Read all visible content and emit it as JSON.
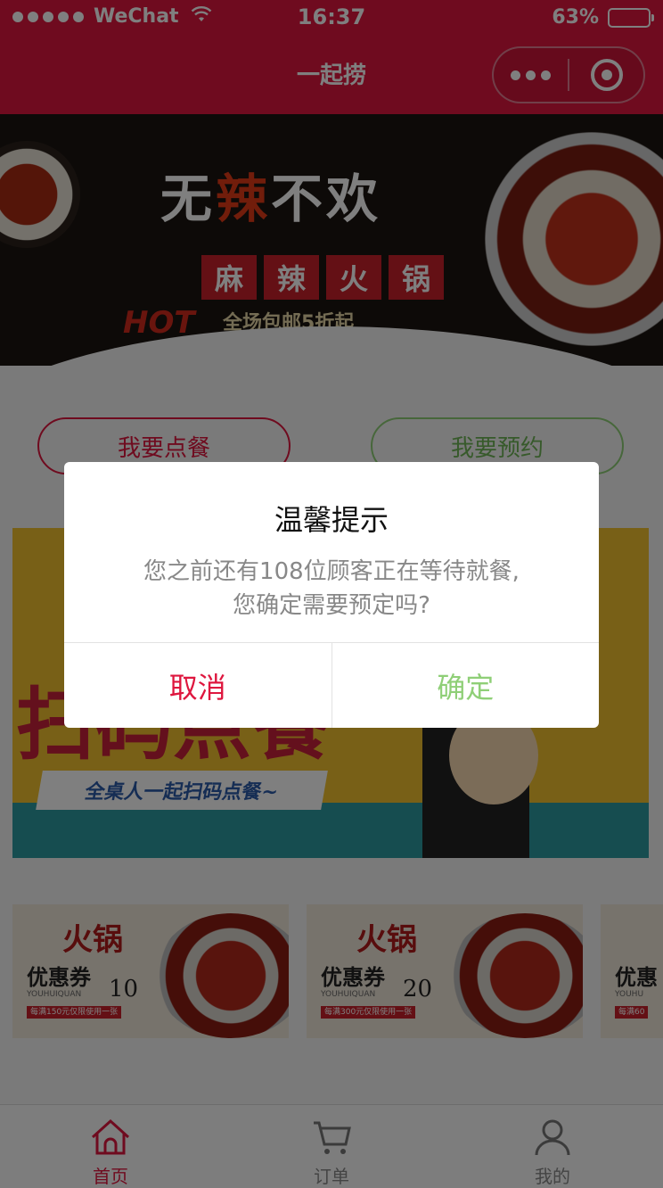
{
  "status_bar": {
    "carrier": "WeChat",
    "time": "16:37",
    "battery": "63%",
    "battery_level": 0.63
  },
  "nav": {
    "title": "一起捞"
  },
  "banner": {
    "headline": "无辣不欢",
    "tags": [
      "麻",
      "辣",
      "火",
      "锅"
    ],
    "hot": "HOT",
    "promo": "全场包邮5折起"
  },
  "actions": {
    "order_label": "我要点餐",
    "book_label": "我要预约"
  },
  "scan_banner": {
    "big_text": "扫码点餐",
    "ribbon_text": "全桌人一起扫码点餐~"
  },
  "coupons": [
    {
      "title": "火锅",
      "label": "优惠券",
      "subtitle": "YOUHUIQUAN",
      "amount": "10",
      "condition": "每满150元仅限使用一张"
    },
    {
      "title": "火锅",
      "label": "优惠券",
      "subtitle": "YOUHUIQUAN",
      "amount": "20",
      "condition": "每满300元仅限使用一张"
    },
    {
      "title": "",
      "label": "优惠",
      "subtitle": "YOUHU",
      "amount": "",
      "condition": "每满60"
    }
  ],
  "tabs": [
    {
      "label": "首页",
      "icon": "home-icon",
      "active": true
    },
    {
      "label": "订单",
      "icon": "cart-icon",
      "active": false
    },
    {
      "label": "我的",
      "icon": "user-icon",
      "active": false
    }
  ],
  "dialog": {
    "title": "温馨提示",
    "message_line1": "您之前还有108位顾客正在等待就餐,",
    "message_line2": "您确定需要预定吗?",
    "cancel_label": "取消",
    "confirm_label": "确定"
  },
  "colors": {
    "brand": "#de163e",
    "confirm": "#8fcf77"
  }
}
